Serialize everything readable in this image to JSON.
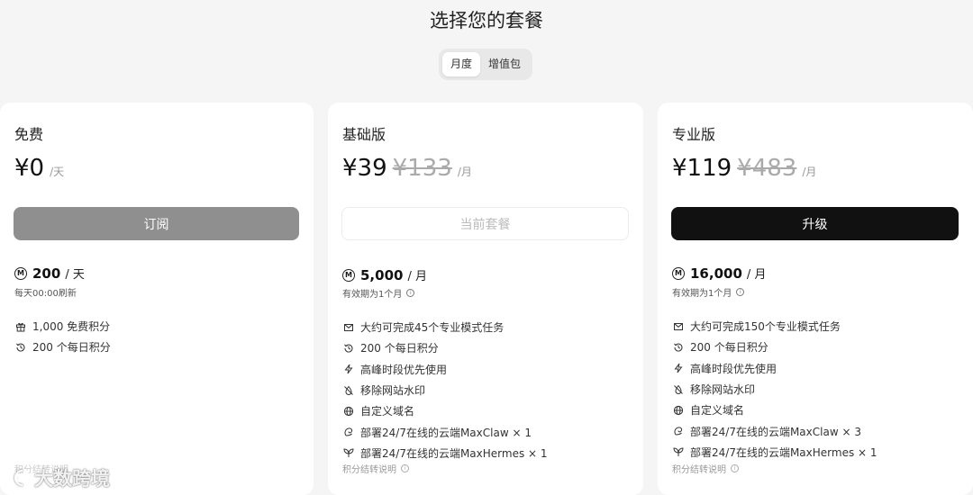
{
  "page": {
    "title": "选择您的套餐"
  },
  "billing_toggle": {
    "options": [
      "月度",
      "增值包"
    ],
    "selected": "月度"
  },
  "colors": {
    "upgrade_button": "#111111",
    "subscribe_button": "#8f8f8f",
    "card_bg": "#ffffff",
    "page_bg": "#f5f5f5"
  },
  "plans": [
    {
      "name": "免费",
      "price": "¥0",
      "price_old": "",
      "period": "/天",
      "button": "订阅",
      "credits": {
        "amount": "200",
        "unit": "/ 天",
        "note": "每天00:00刷新"
      },
      "features": [
        {
          "icon": "gift-icon",
          "text": "1,000 免费积分"
        },
        {
          "icon": "history-icon",
          "text": "200 个每日积分"
        }
      ],
      "footnote": "积分结转说明"
    },
    {
      "name": "基础版",
      "price": "¥39",
      "price_old": "¥133",
      "period": "/月",
      "button": "当前套餐",
      "credits": {
        "amount": "5,000",
        "unit": "/ 月",
        "note": "有效期为1个月"
      },
      "features": [
        {
          "icon": "mail-icon",
          "text": "大约可完成45个专业模式任务"
        },
        {
          "icon": "history-icon",
          "text": "200 个每日积分"
        },
        {
          "icon": "bolt-icon",
          "text": "高峰时段优先使用"
        },
        {
          "icon": "no-watermark-icon",
          "text": "移除网站水印"
        },
        {
          "icon": "globe-icon",
          "text": "自定义域名"
        },
        {
          "icon": "claw-icon",
          "text": "部署24/7在线的云端MaxClaw × 1"
        },
        {
          "icon": "leaf-icon",
          "text": "部署24/7在线的云端MaxHermes × 1"
        }
      ],
      "footnote": "积分结转说明"
    },
    {
      "name": "专业版",
      "price": "¥119",
      "price_old": "¥483",
      "period": "/月",
      "button": "升级",
      "credits": {
        "amount": "16,000",
        "unit": "/ 月",
        "note": "有效期为1个月"
      },
      "features": [
        {
          "icon": "mail-icon",
          "text": "大约可完成150个专业模式任务"
        },
        {
          "icon": "history-icon",
          "text": "200 个每日积分"
        },
        {
          "icon": "bolt-icon",
          "text": "高峰时段优先使用"
        },
        {
          "icon": "no-watermark-icon",
          "text": "移除网站水印"
        },
        {
          "icon": "globe-icon",
          "text": "自定义域名"
        },
        {
          "icon": "claw-icon",
          "text": "部署24/7在线的云端MaxClaw × 3"
        },
        {
          "icon": "leaf-icon",
          "text": "部署24/7在线的云端MaxHermes × 1"
        }
      ],
      "footnote": "积分结转说明"
    }
  ],
  "watermark": {
    "text": "大数跨境"
  }
}
